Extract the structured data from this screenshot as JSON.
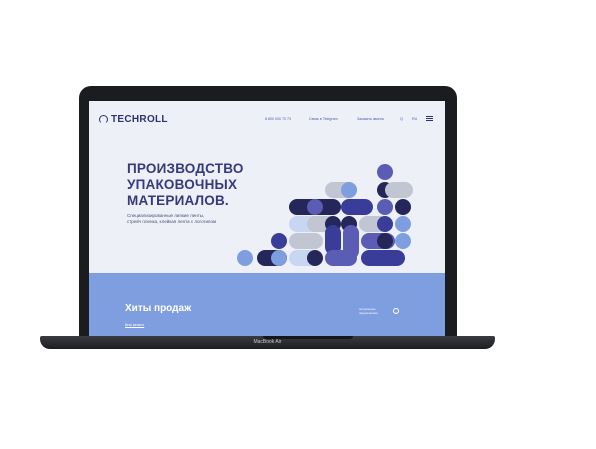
{
  "device": {
    "label": "MacBook Air"
  },
  "header": {
    "logo_text": "TECHROLL",
    "phone": "8 800 000 70 73",
    "callback": "Связь в Telegram",
    "order": "Заказать звонок",
    "search": "Q",
    "lang": "RU"
  },
  "hero": {
    "title": [
      "ПРОИЗВОДСТВО",
      "УПАКОВОЧНЫХ",
      "МАТЕРИАЛОВ."
    ],
    "subtitle": [
      "Специализированные липкие ленты,",
      "стрейч пленка, клейкая лента с логотипом"
    ]
  },
  "band": {
    "title": "Хиты продаж",
    "link": "Весь каталог",
    "note": [
      "Актуальные",
      "предложения"
    ],
    "arrow": "→"
  },
  "colors": {
    "navy": "#25275a",
    "indigo": "#3a3c99",
    "purple": "#5b5cb4",
    "light": "#7e9ee0",
    "pale": "#c9d6f2",
    "gray": "#c2c5d2",
    "band": "#7e9ee0"
  },
  "icons": [
    "logo-mark-icon",
    "search-icon",
    "menu-icon",
    "arrow-right-icon"
  ]
}
